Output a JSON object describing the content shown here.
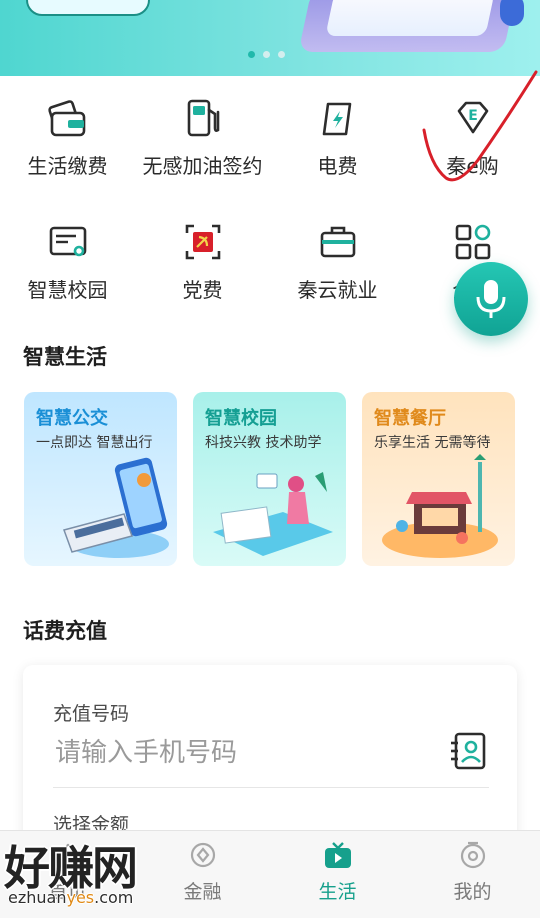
{
  "banner": {
    "page_dots": 3,
    "active_dot": 1
  },
  "services": [
    {
      "label": "生活缴费",
      "icon": "wallet-card-icon"
    },
    {
      "label": "无感加油签约",
      "icon": "fuel-pump-icon"
    },
    {
      "label": "电费",
      "icon": "electricity-icon"
    },
    {
      "label": "秦e购",
      "icon": "diamond-e-icon"
    },
    {
      "label": "智慧校园",
      "icon": "campus-card-icon"
    },
    {
      "label": "党费",
      "icon": "party-emblem-icon"
    },
    {
      "label": "秦云就业",
      "icon": "briefcase-icon"
    },
    {
      "label": "全部",
      "icon": "all-apps-grid-icon"
    }
  ],
  "sections": {
    "smart_life": "智慧生活",
    "topup": "话费充值"
  },
  "cards": [
    {
      "title": "智慧公交",
      "subtitle": "一点即达 智慧出行",
      "title_color": "#1a8fd6"
    },
    {
      "title": "智慧校园",
      "subtitle": "科技兴教 技术助学",
      "title_color": "#159f93"
    },
    {
      "title": "智慧餐厅",
      "subtitle": "乐享生活 无需等待",
      "title_color": "#e08a1c"
    }
  ],
  "recharge": {
    "phone_label": "充值号码",
    "phone_placeholder": "请输入手机号码",
    "amount_label": "选择金额"
  },
  "nav": [
    {
      "label": "首页",
      "icon": "home-icon"
    },
    {
      "label": "金融",
      "icon": "finance-icon"
    },
    {
      "label": "生活",
      "icon": "tv-life-icon",
      "active": true
    },
    {
      "label": "我的",
      "icon": "profile-icon"
    }
  ],
  "watermark": {
    "logo_text": "好赚网",
    "url_prefix": "ezhuan",
    "url_mid": "yes",
    "url_suffix": ".com"
  },
  "colors": {
    "accent": "#16a08c",
    "annotation": "#d8202a"
  }
}
